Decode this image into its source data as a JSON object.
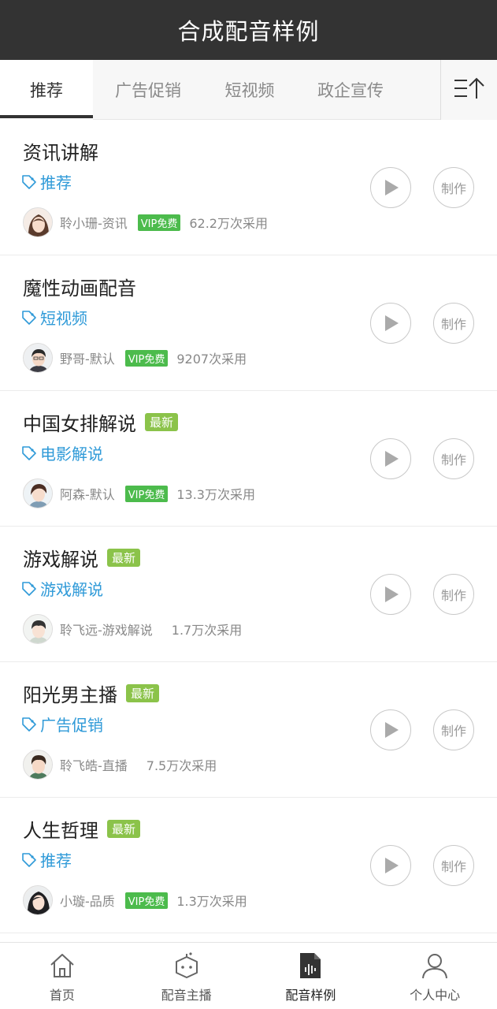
{
  "header": {
    "title": "合成配音样例"
  },
  "tabs": [
    {
      "label": "推荐",
      "active": true
    },
    {
      "label": "广告促销",
      "active": false
    },
    {
      "label": "短视频",
      "active": false
    },
    {
      "label": "政企宣传",
      "active": false
    }
  ],
  "tab_more_icon": "sort-to-top-icon",
  "colors": {
    "header_bg": "#333333",
    "tag_blue": "#2f9ad8",
    "new_badge": "#8bc34a",
    "vip_badge": "#4cbb4c"
  },
  "items": [
    {
      "title": "资讯讲解",
      "is_new": false,
      "new_label": "",
      "tag": "推荐",
      "author": "聆小珊-资讯",
      "vip": true,
      "vip_label": "VIP免费",
      "uses": "62.2万次采用",
      "play_icon": "play-icon",
      "make_label": "制作"
    },
    {
      "title": "魔性动画配音",
      "is_new": false,
      "new_label": "",
      "tag": "短视频",
      "author": "野哥-默认",
      "vip": true,
      "vip_label": "VIP免费",
      "uses": "9207次采用",
      "play_icon": "play-icon",
      "make_label": "制作"
    },
    {
      "title": "中国女排解说",
      "is_new": true,
      "new_label": "最新",
      "tag": "电影解说",
      "author": "阿森-默认",
      "vip": true,
      "vip_label": "VIP免费",
      "uses": "13.3万次采用",
      "play_icon": "play-icon",
      "make_label": "制作"
    },
    {
      "title": "游戏解说",
      "is_new": true,
      "new_label": "最新",
      "tag": "游戏解说",
      "author": "聆飞远-游戏解说",
      "vip": false,
      "vip_label": "",
      "uses": "1.7万次采用",
      "play_icon": "play-icon",
      "make_label": "制作"
    },
    {
      "title": "阳光男主播",
      "is_new": true,
      "new_label": "最新",
      "tag": "广告促销",
      "author": "聆飞皓-直播",
      "vip": false,
      "vip_label": "",
      "uses": "7.5万次采用",
      "play_icon": "play-icon",
      "make_label": "制作"
    },
    {
      "title": "人生哲理",
      "is_new": true,
      "new_label": "最新",
      "tag": "推荐",
      "author": "小璇-品质",
      "vip": true,
      "vip_label": "VIP免费",
      "uses": "1.3万次采用",
      "play_icon": "play-icon",
      "make_label": "制作"
    }
  ],
  "bottom_nav": [
    {
      "label": "首页",
      "icon": "home-icon",
      "active": false
    },
    {
      "label": "配音主播",
      "icon": "robot-icon",
      "active": false
    },
    {
      "label": "配音样例",
      "icon": "audio-file-icon",
      "active": true
    },
    {
      "label": "个人中心",
      "icon": "user-icon",
      "active": false
    }
  ]
}
